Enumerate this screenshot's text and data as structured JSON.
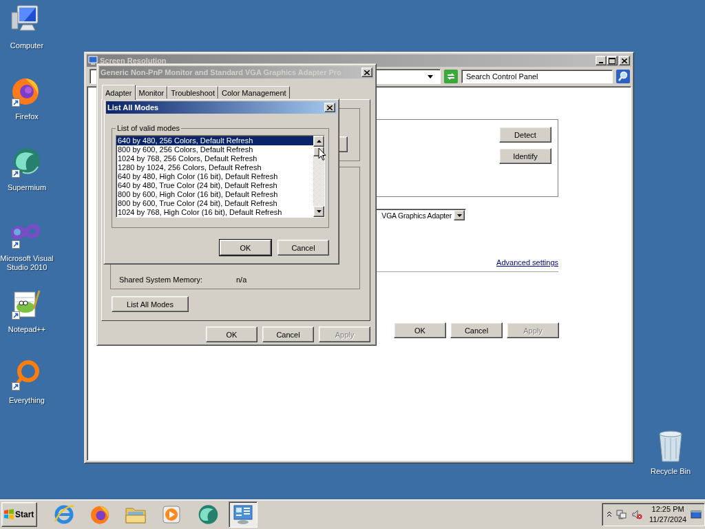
{
  "desktop_icons": [
    {
      "kind": "computer",
      "label": "Computer",
      "shortcut": false
    },
    {
      "kind": "firefox",
      "label": "Firefox",
      "shortcut": true
    },
    {
      "kind": "supermium",
      "label": "Supermium",
      "shortcut": true
    },
    {
      "kind": "visual_studio",
      "label": "Microsoft Visual Studio 2010",
      "shortcut": true
    },
    {
      "kind": "notepadpp",
      "label": "Notepad++",
      "shortcut": true
    },
    {
      "kind": "everything",
      "label": "Everything",
      "shortcut": true
    }
  ],
  "recycle_bin": {
    "label": "Recycle Bin"
  },
  "screen_resolution": {
    "title": "Screen Resolution",
    "search": {
      "placeholder": "Search Control Panel"
    },
    "display_buttons": [
      {
        "label": "Detect"
      },
      {
        "label": "Identify"
      }
    ],
    "display_dropdown": {
      "value": "VGA Graphics Adapter"
    },
    "advanced_link": "Advanced settings",
    "buttons": [
      {
        "label": "OK",
        "disabled": false
      },
      {
        "label": "Cancel",
        "disabled": false
      },
      {
        "label": "Apply",
        "disabled": true
      }
    ]
  },
  "adapter_dialog": {
    "title": "Generic Non-PnP Monitor and Standard VGA Graphics Adapter Pro",
    "tabs": [
      {
        "label": "Adapter",
        "selected": true
      },
      {
        "label": "Monitor",
        "selected": false
      },
      {
        "label": "Troubleshoot",
        "selected": false
      },
      {
        "label": "Color Management",
        "selected": false
      }
    ],
    "memory": [
      {
        "label": "Shared System Memory:",
        "value": "n/a"
      }
    ],
    "list_all_button": "List All Modes",
    "buttons": [
      {
        "label": "OK",
        "disabled": false
      },
      {
        "label": "Cancel",
        "disabled": false
      },
      {
        "label": "Apply",
        "disabled": true
      }
    ]
  },
  "modes_dialog": {
    "title": "List All Modes",
    "group_label": "List of valid modes",
    "modes": [
      {
        "label": "640 by 480, 256 Colors, Default Refresh",
        "selected": true
      },
      {
        "label": "800 by 600, 256 Colors, Default Refresh",
        "selected": false
      },
      {
        "label": "1024 by 768, 256 Colors, Default Refresh",
        "selected": false
      },
      {
        "label": "1280 by 1024, 256 Colors, Default Refresh",
        "selected": false
      },
      {
        "label": "640 by 480, High Color (16 bit), Default Refresh",
        "selected": false
      },
      {
        "label": "640 by 480, True Color (24 bit), Default Refresh",
        "selected": false
      },
      {
        "label": "800 by 600, High Color (16 bit), Default Refresh",
        "selected": false
      },
      {
        "label": "800 by 600, True Color (24 bit), Default Refresh",
        "selected": false
      },
      {
        "label": "1024 by 768, High Color (16 bit), Default Refresh",
        "selected": false
      }
    ],
    "buttons": [
      {
        "label": "OK",
        "default": true
      },
      {
        "label": "Cancel",
        "default": false
      }
    ]
  },
  "taskbar": {
    "start": "Start",
    "apps": [
      {
        "kind": "ie",
        "active": false
      },
      {
        "kind": "firefox",
        "active": false
      },
      {
        "kind": "explorer",
        "active": false
      },
      {
        "kind": "media_player",
        "active": false
      },
      {
        "kind": "supermium",
        "active": false
      },
      {
        "kind": "control_panel",
        "active": true
      }
    ],
    "clock": {
      "time": "12:25 PM",
      "date": "11/27/2024"
    }
  }
}
